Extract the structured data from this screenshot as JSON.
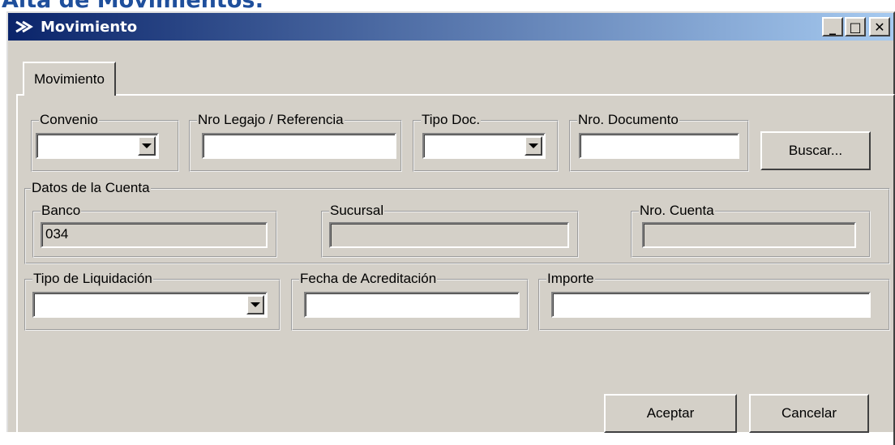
{
  "page": {
    "heading": "Alta de Movimientos:"
  },
  "window": {
    "title": "Movimiento",
    "icon": "arrow-icon",
    "controls": {
      "minimize": "_",
      "maximize": "□",
      "close": "✕"
    }
  },
  "tab": {
    "label": "Movimiento"
  },
  "top_row": {
    "convenio": {
      "label": "Convenio",
      "value": ""
    },
    "legajo": {
      "label": "Nro Legajo / Referencia",
      "value": ""
    },
    "tipo_doc": {
      "label": "Tipo Doc.",
      "value": ""
    },
    "nro_documento": {
      "label": "Nro. Documento",
      "value": ""
    },
    "buscar": "Buscar..."
  },
  "cuenta": {
    "label": "Datos de la Cuenta",
    "banco": {
      "label": "Banco",
      "value": "034"
    },
    "sucursal": {
      "label": "Sucursal",
      "value": ""
    },
    "nro_cuenta": {
      "label": "Nro. Cuenta",
      "value": ""
    }
  },
  "bottom_row": {
    "tipo_liquidacion": {
      "label": "Tipo de Liquidación",
      "value": ""
    },
    "fecha_acreditacion": {
      "label": "Fecha de Acreditación",
      "value": ""
    },
    "importe": {
      "label": "Importe",
      "value": ""
    }
  },
  "actions": {
    "aceptar": "Aceptar",
    "cancelar": "Cancelar"
  },
  "colors": {
    "heading": "#1f4f9c",
    "titlebar_start": "#0a246a",
    "titlebar_end": "#a6caf0",
    "face": "#d4d0c8"
  }
}
